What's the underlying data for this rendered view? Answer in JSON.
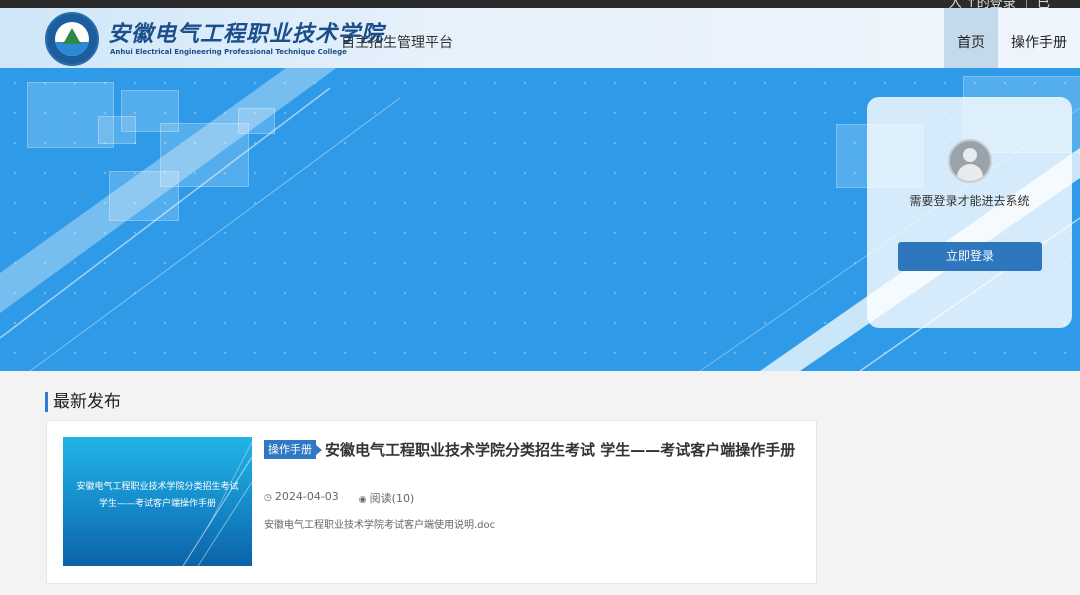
{
  "topbar": {
    "text": "入 ↑的登录 ｜ 已"
  },
  "header": {
    "school_name_cn": "安徽电气工程职业技术学院",
    "school_name_en": "Anhui Electrical Engineering Professional Technique College",
    "platform_name": "自主招生管理平台",
    "nav": [
      {
        "label": "首页",
        "active": true
      },
      {
        "label": "操作手册",
        "active": false
      }
    ]
  },
  "login": {
    "avatar_icon": "user-avatar-icon",
    "message": "需要登录才能进去系统",
    "button_label": "立即登录"
  },
  "latest": {
    "section_title": "最新发布",
    "articles": [
      {
        "thumbnail_text": "安徽电气工程职业技术学院分类招生考试 学生——考试客户端操作手册",
        "tag": "操作手册",
        "title": "安徽电气工程职业技术学院分类招生考试 学生——考试客户端操作手册",
        "date": "2024-04-03",
        "views": "阅读(10)",
        "description": "安徽电气工程职业技术学院考试客户端使用说明.doc"
      }
    ]
  },
  "colors": {
    "hero_bg": "#2f9be8",
    "accent": "#2e78c4"
  }
}
